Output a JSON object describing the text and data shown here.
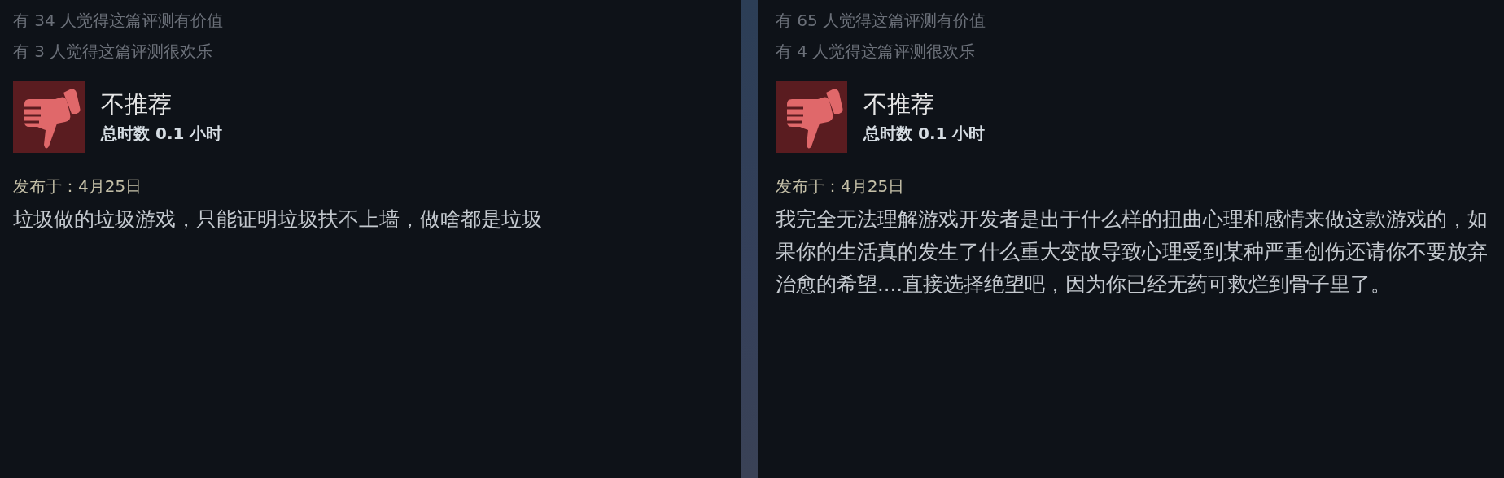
{
  "reviews": [
    {
      "helpful": "有 34 人觉得这篇评测有价值",
      "funny": "有 3 人觉得这篇评测很欢乐",
      "recommended": false,
      "verdict": "不推荐",
      "hours": "总时数 0.1 小时",
      "posted": "发布于：4月25日",
      "body": "垃圾做的垃圾游戏，只能证明垃圾扶不上墙，做啥都是垃圾"
    },
    {
      "helpful": "有 65 人觉得这篇评测有价值",
      "funny": "有 4 人觉得这篇评测很欢乐",
      "recommended": false,
      "verdict": "不推荐",
      "hours": "总时数 0.1 小时",
      "posted": "发布于：4月25日",
      "body": "我完全无法理解游戏开发者是出于什么样的扭曲心理和感情来做这款游戏的，如果你的生活真的发生了什么重大变故导致心理受到某种严重创伤还请你不要放弃治愈的希望....直接选择绝望吧，因为你已经无药可救烂到骨子里了。"
    }
  ]
}
